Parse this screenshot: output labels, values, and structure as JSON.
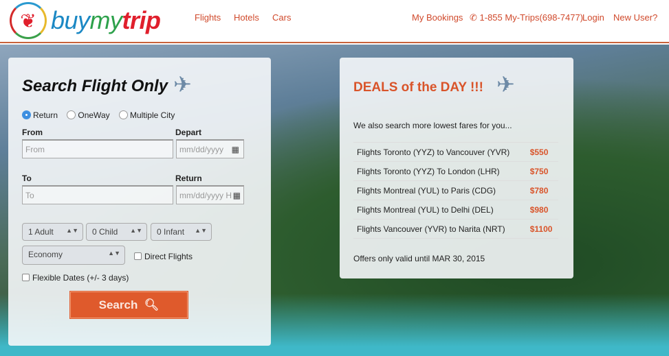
{
  "header": {
    "logo": "buymytrip",
    "logo_parts": [
      "buy",
      "my",
      "trip"
    ],
    "nav": [
      "Flights",
      "Hotels",
      "Cars"
    ],
    "right": {
      "bookings": "My Bookings",
      "phone": "1-855 My-Trips(698-7477)",
      "login": "Login",
      "new_user": "New User?"
    }
  },
  "search": {
    "title": "Search Flight Only",
    "trip_types": [
      {
        "label": "Return",
        "selected": true
      },
      {
        "label": "OneWay",
        "selected": false
      },
      {
        "label": "Multiple City",
        "selected": false
      }
    ],
    "from_label": "From",
    "from_placeholder": "From",
    "depart_label": "Depart",
    "depart_placeholder": "mm/dd/yyyy",
    "to_label": "To",
    "to_placeholder": "To",
    "return_label": "Return",
    "return_placeholder": "mm/dd/yyyy H",
    "adults": "1 Adult",
    "children": "0 Child",
    "infants": "0 Infant",
    "cabin": "Economy",
    "direct": "Direct Flights",
    "flexible": "Flexible Dates (+/- 3 days)",
    "button": "Search"
  },
  "deals": {
    "title": "DEALS of the DAY !!!",
    "intro": "We also search more lowest fares for you...",
    "rows": [
      {
        "route": "Flights Toronto (YYZ) to Vancouver (YVR)",
        "price": "$550"
      },
      {
        "route": "Flights Toronto (YYZ) To London (LHR)",
        "price": "$750"
      },
      {
        "route": "Flights Montreal (YUL) to Paris (CDG)",
        "price": "$780"
      },
      {
        "route": "Flights Montreal (YUL) to Delhi (DEL)",
        "price": "$980"
      },
      {
        "route": "Flights Vancouver (YVR) to Narita (NRT)",
        "price": "$1100"
      }
    ],
    "footer": "Offers only valid until MAR 30, 2015"
  },
  "colors": {
    "accent": "#d9542a",
    "button": "#df5a2c"
  }
}
